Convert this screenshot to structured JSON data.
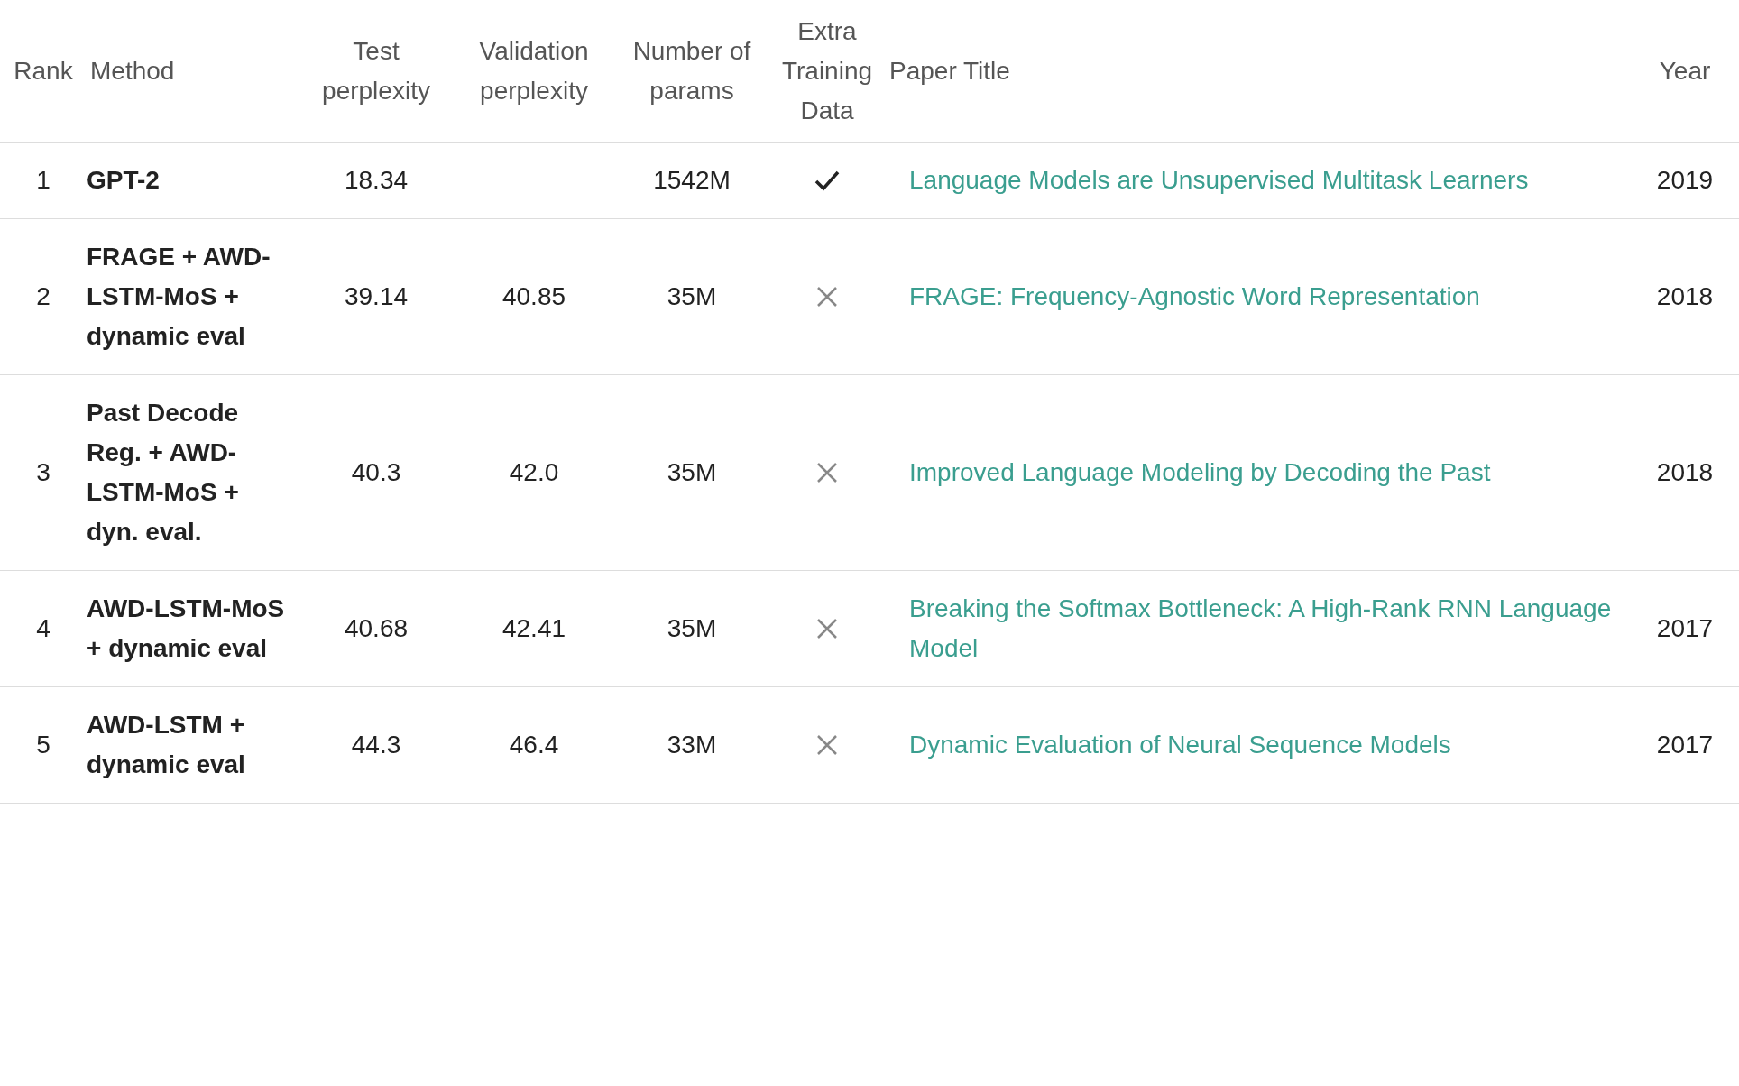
{
  "table": {
    "columns": [
      "Rank",
      "Method",
      "Test perplexity",
      "Validation perplexity",
      "Number of params",
      "Extra Training Data",
      "Paper Title",
      "Year"
    ],
    "rows": [
      {
        "rank": "1",
        "method": "GPT-2",
        "test_perplexity": "18.34",
        "number_of_params": "1542M",
        "extra_training_data": true,
        "paper_title": "Language Models are Unsupervised Multitask Learners",
        "year": "2019"
      },
      {
        "rank": "2",
        "method": "FRAGE + AWD-LSTM-MoS + dynamic eval",
        "test_perplexity": "39.14",
        "validation_perplexity": "40.85",
        "number_of_params": "35M",
        "extra_training_data": false,
        "paper_title": "FRAGE: Frequency-Agnostic Word Representation",
        "year": "2018"
      },
      {
        "rank": "3",
        "method": "Past Decode Reg. + AWD-LSTM-MoS + dyn. eval.",
        "test_perplexity": "40.3",
        "validation_perplexity": "42.0",
        "number_of_params": "35M",
        "extra_training_data": false,
        "paper_title": "Improved Language Modeling by Decoding the Past",
        "year": "2018"
      },
      {
        "rank": "4",
        "method": "AWD-LSTM-MoS + dynamic eval",
        "test_perplexity": "40.68",
        "validation_perplexity": "42.41",
        "number_of_params": "35M",
        "extra_training_data": false,
        "paper_title": "Breaking the Softmax Bottleneck: A High-Rank RNN Language Model",
        "year": "2017"
      },
      {
        "rank": "5",
        "method": "AWD-LSTM + dynamic eval",
        "test_perplexity": "44.3",
        "validation_perplexity": "46.4",
        "number_of_params": "33M",
        "extra_training_data": false,
        "paper_title": "Dynamic Evaluation of Neural Sequence Models",
        "year": "2017"
      }
    ]
  }
}
